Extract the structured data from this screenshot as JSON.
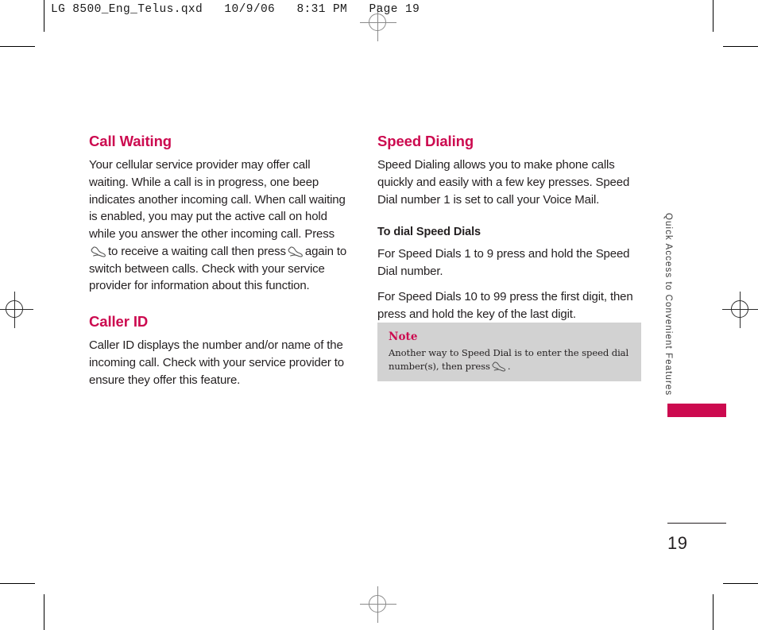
{
  "header": {
    "slug": "LG 8500_Eng_Telus.qxd   10/9/06   8:31 PM   Page 19"
  },
  "colors": {
    "accent_magenta": "#cc0a4f",
    "body_text": "#231f20",
    "note_background": "#d2d2d2"
  },
  "left_column": {
    "call_waiting": {
      "title": "Call Waiting",
      "paragraph_part1": "Your cellular service provider may offer call waiting. While a call is in progress, one beep indicates another incoming call. When call waiting is enabled, you may put the active call on hold while you answer the other incoming call. Press",
      "paragraph_part2": "to receive a waiting call then press",
      "paragraph_part3": "again to switch between calls. Check with your service provider for information about this function."
    },
    "caller_id": {
      "title": "Caller ID",
      "paragraph": "Caller ID displays the number and/or name of the incoming call. Check with your service provider to ensure they offer this feature."
    }
  },
  "right_column": {
    "speed_dialing": {
      "title": "Speed Dialing",
      "intro": "Speed Dialing allows you to make phone calls quickly and easily with a few key presses. Speed Dial number 1 is set to call your Voice Mail.",
      "subheading": "To dial Speed Dials",
      "paragraph1": "For Speed Dials 1 to 9 press and hold the Speed Dial number.",
      "paragraph2": "For Speed Dials 10 to 99 press the first digit, then press and hold the key of the last digit."
    },
    "note": {
      "title": "Note",
      "text_part1": "Another way to Speed Dial is to enter the speed dial number(s), then press",
      "text_part2": "."
    }
  },
  "side_tab": {
    "label": "Quick Access to Convenient Features"
  },
  "page_number": "19",
  "icons": {
    "send_key": "send-key-icon"
  }
}
